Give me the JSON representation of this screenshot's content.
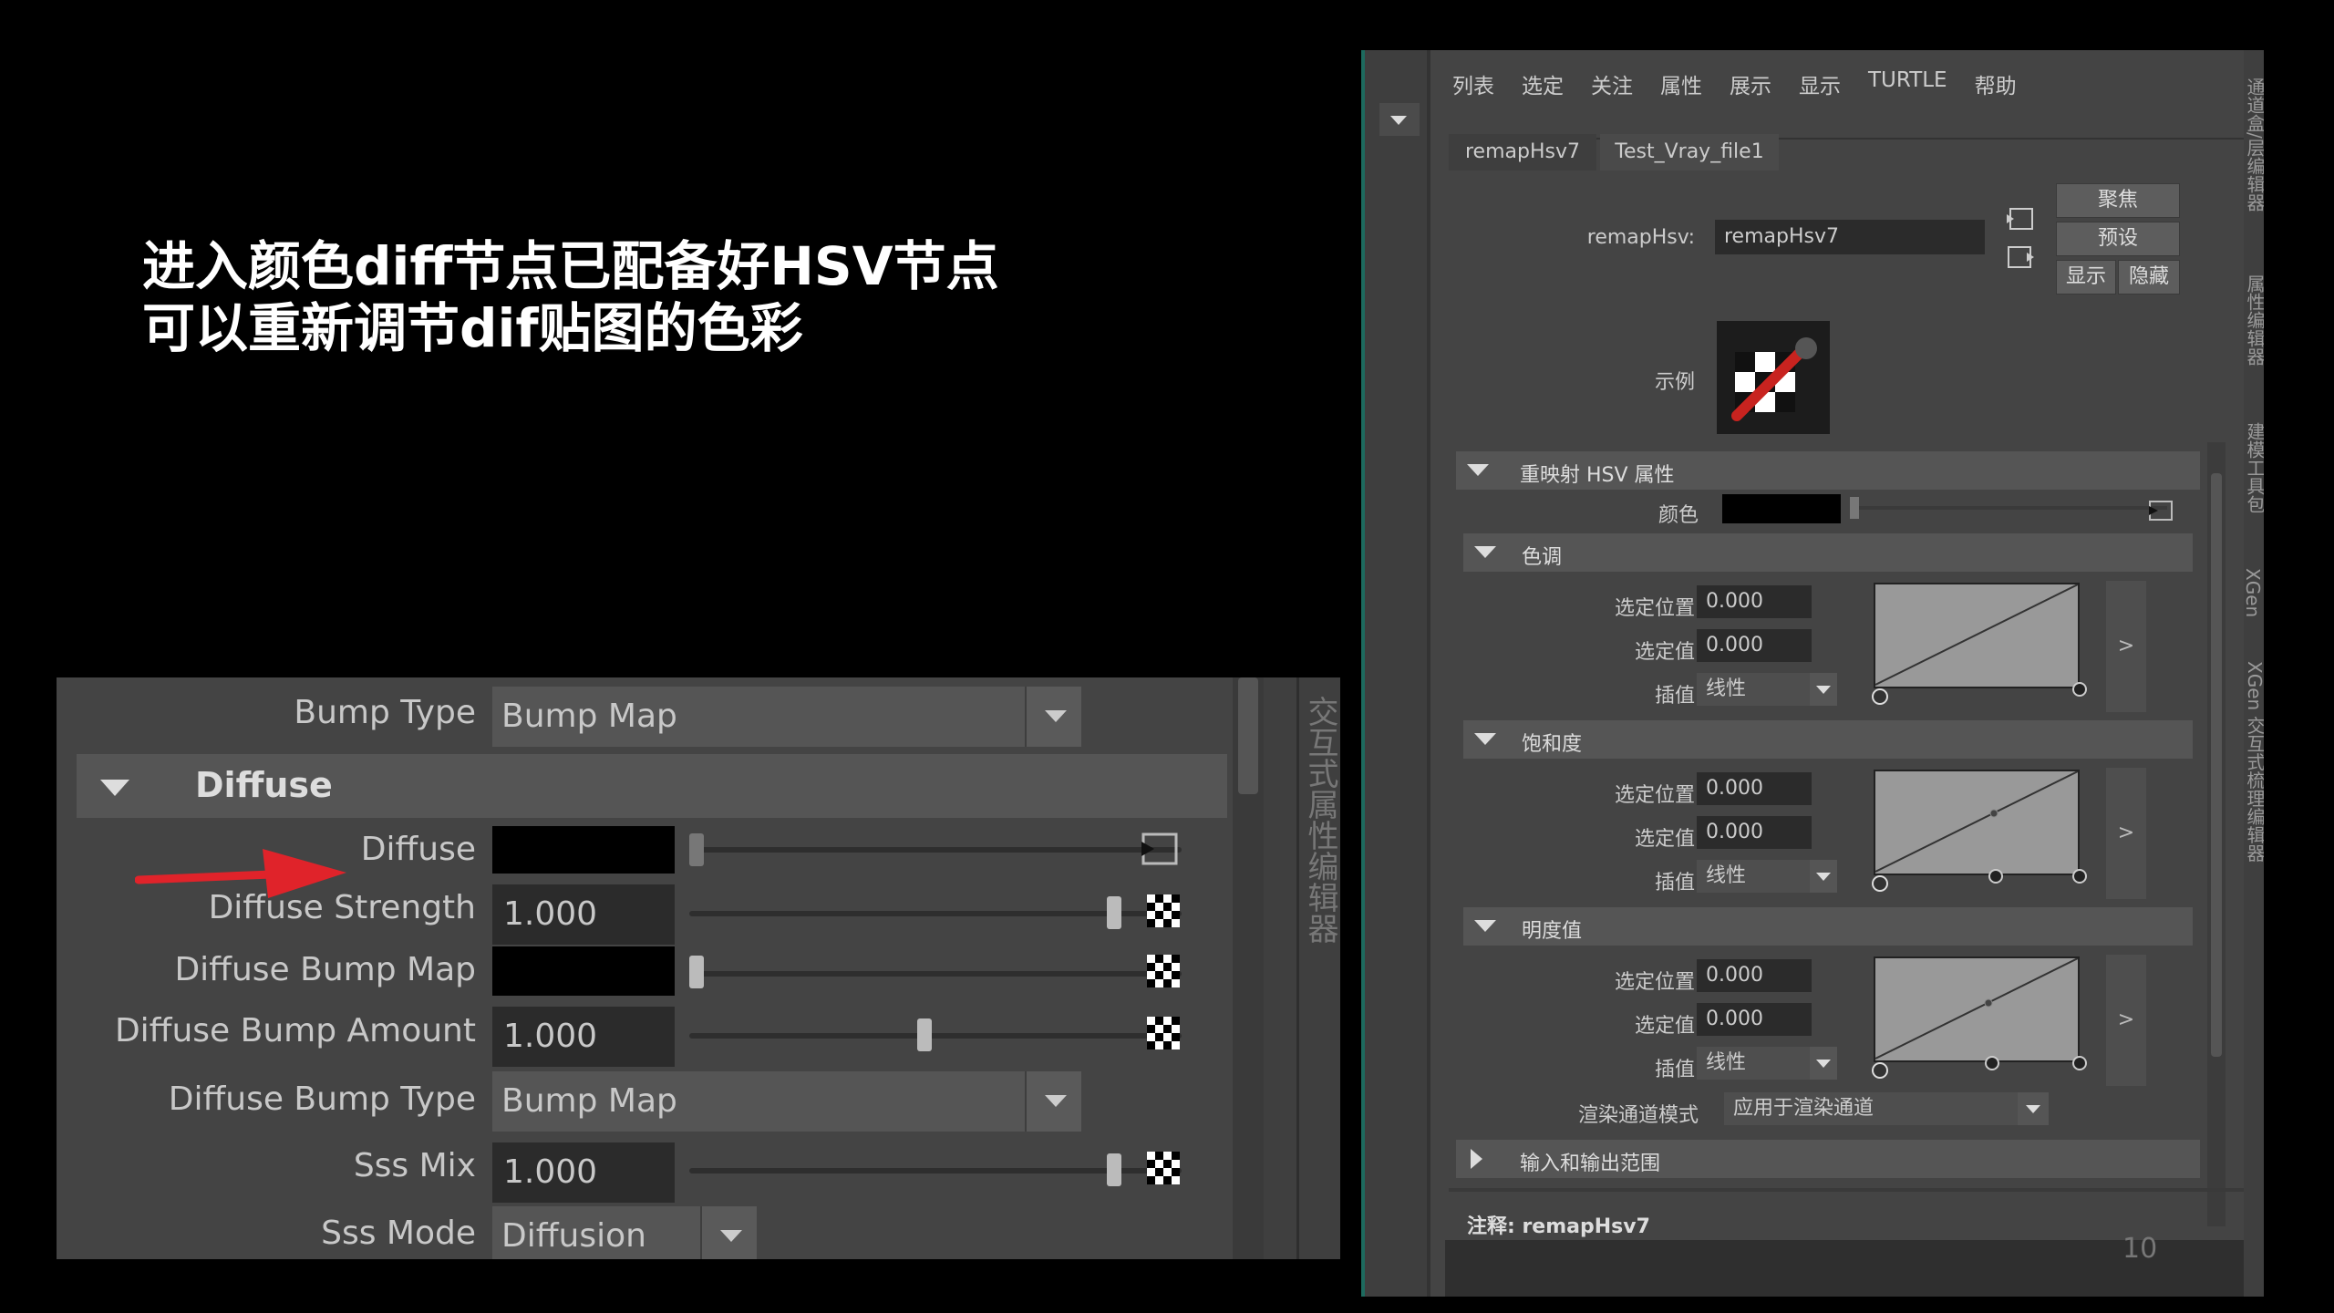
{
  "caption": {
    "line1": "进入颜色diff节点已配备好HSV节点",
    "line2": "可以重新调节dif贴图的色彩"
  },
  "page_number": "10",
  "left_panel": {
    "bump_type_label": "Bump Type",
    "bump_type_value": "Bump Map",
    "section_title": "Diffuse",
    "rows": {
      "diffuse_label": "Diffuse",
      "diffuse_strength_label": "Diffuse Strength",
      "diffuse_strength_value": "1.000",
      "diffuse_strength_level": 1.0,
      "diffuse_bump_map_label": "Diffuse Bump Map",
      "diffuse_bump_amount_label": "Diffuse Bump Amount",
      "diffuse_bump_amount_value": "1.000",
      "diffuse_bump_amount_level": 0.55,
      "diffuse_bump_type_label": "Diffuse Bump Type",
      "diffuse_bump_type_value": "Bump Map",
      "sss_mix_label": "Sss Mix",
      "sss_mix_value": "1.000",
      "sss_mix_level": 1.0,
      "sss_mode_label": "Sss Mode",
      "sss_mode_value": "Diffusion"
    },
    "side_tab": "交互式属性编辑器",
    "arrow_color": "#e0232a"
  },
  "right_panel": {
    "menu": [
      "列表",
      "选定",
      "关注",
      "属性",
      "展示",
      "显示",
      "TURTLE",
      "帮助"
    ],
    "tabs": [
      "remapHsv7",
      "Test_Vray_file1"
    ],
    "node_label": "remapHsv:",
    "node_value": "remapHsv7",
    "buttons": {
      "focus": "聚焦",
      "preset": "预设",
      "show": "显示",
      "hide": "隐藏"
    },
    "sample_label": "示例",
    "section_main": "重映射 HSV 属性",
    "color_label": "颜色",
    "groups": [
      {
        "title": "色调",
        "pos_label": "选定位置",
        "pos_value": "0.000",
        "val_label": "选定值",
        "val_value": "0.000",
        "interp_label": "插值",
        "interp_value": "线性"
      },
      {
        "title": "饱和度",
        "pos_label": "选定位置",
        "pos_value": "0.000",
        "val_label": "选定值",
        "val_value": "0.000",
        "interp_label": "插值",
        "interp_value": "线性"
      },
      {
        "title": "明度值",
        "pos_label": "选定位置",
        "pos_value": "0.000",
        "val_label": "选定值",
        "val_value": "0.000",
        "interp_label": "插值",
        "interp_value": "线性"
      }
    ],
    "expand_symbol": ">",
    "render_mode_label": "渲染通道模式",
    "render_mode_value": "应用于渲染通道",
    "io_range": "输入和输出范围",
    "notes_label": "注释: remapHsv7",
    "vertical_tabs": [
      "通道盒/层编辑器",
      "属性编辑器",
      "建模工具包",
      "XGen",
      "XGen 交互式梳理编辑器"
    ]
  }
}
